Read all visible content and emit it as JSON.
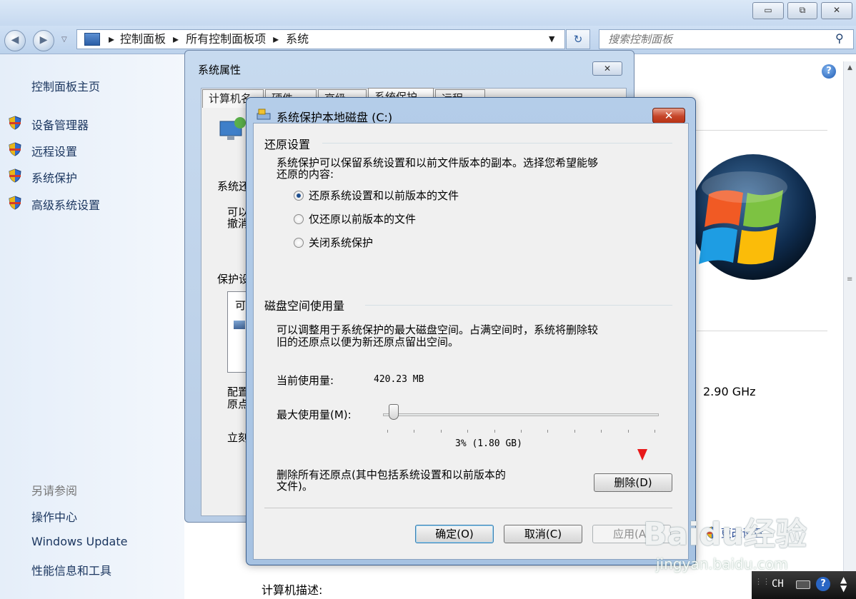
{
  "breadcrumb": {
    "sep": "▸",
    "items": [
      "控制面板",
      "所有控制面板项",
      "系统"
    ]
  },
  "search": {
    "placeholder": "搜索控制面板"
  },
  "sidebar": {
    "home": "控制面板主页",
    "items": [
      {
        "label": "设备管理器"
      },
      {
        "label": "远程设置"
      },
      {
        "label": "系统保护"
      },
      {
        "label": "高级系统设置"
      }
    ],
    "see_also_title": "另请参阅",
    "see_also": [
      "操作中心",
      "Windows Update",
      "性能信息和工具"
    ]
  },
  "main": {
    "cpu_speed": "2.90 GHz",
    "change_settings": "更改设置",
    "computer_description_label": "计算机描述:"
  },
  "sysprops": {
    "title": "系统属性",
    "tabs": [
      "计算机名",
      "硬件",
      "高级",
      "系统保护",
      "远程"
    ],
    "fragments": {
      "f1": "系统还",
      "f2": "可以",
      "f3": "撤消",
      "f4": "保护设",
      "f5": "可",
      "f6": "配置",
      "f7": "原点",
      "f8": "立刻"
    }
  },
  "dialog": {
    "title": "系统保护本地磁盘 (C:)",
    "restore_group": "还原设置",
    "restore_desc_1": "系统保护可以保留系统设置和以前文件版本的副本。选择您希望能够",
    "restore_desc_2": "还原的内容:",
    "options": [
      {
        "label": "还原系统设置和以前版本的文件",
        "selected": true
      },
      {
        "label": "仅还原以前版本的文件",
        "selected": false
      },
      {
        "label": "关闭系统保护",
        "selected": false
      }
    ],
    "disk_group": "磁盘空间使用量",
    "disk_desc_1": "可以调整用于系统保护的最大磁盘空间。占满空间时，系统将删除较",
    "disk_desc_2": "旧的还原点以便为新还原点留出空间。",
    "current_usage_label": "当前使用量:",
    "current_usage_value": "420.23 MB",
    "max_usage_label": "最大使用量(M):",
    "max_usage_fraction": 0.03,
    "max_usage_value": "3% (1.80 GB)",
    "delete_desc_1": "删除所有还原点(其中包括系统设置和以前版本的",
    "delete_desc_2": "文件)。",
    "delete_button": "删除(D)",
    "ok_button": "确定(O)",
    "cancel_button": "取消(C)",
    "apply_button": "应用(A)",
    "marker_color": "#e8191a"
  },
  "watermark": {
    "text": "Baidu经验",
    "sub": "jingyan.baidu.com"
  },
  "tray": {
    "lang": "CH"
  }
}
